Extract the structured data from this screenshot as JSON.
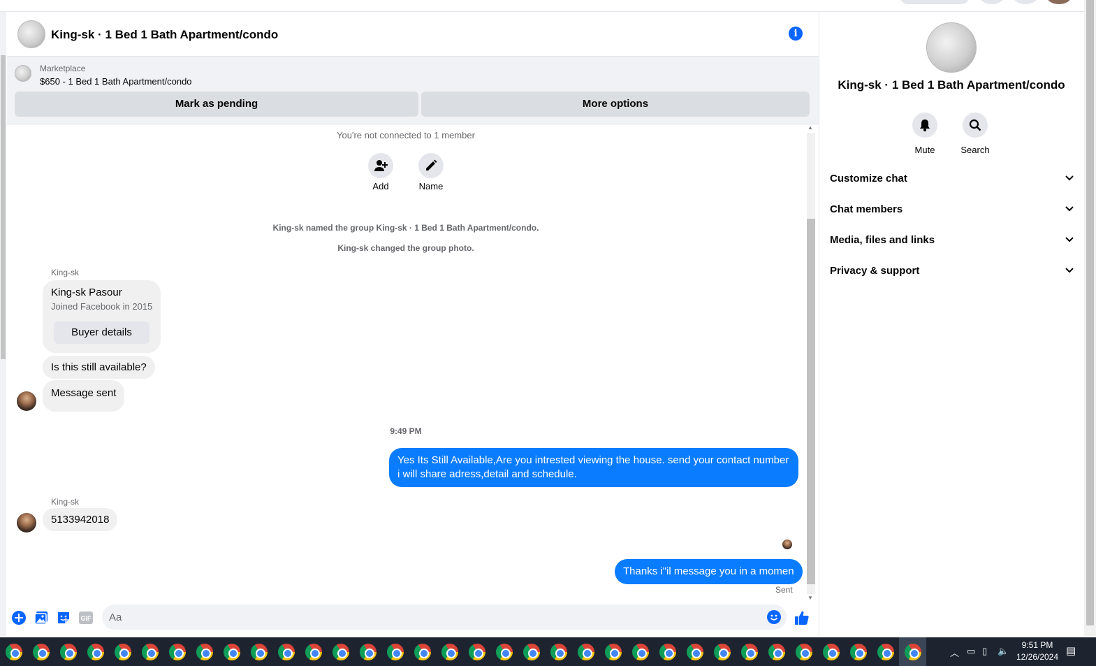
{
  "chat": {
    "title": "King-sk · 1 Bed 1 Bath Apartment/condo",
    "marketplace_label": "Marketplace",
    "listing_title": "$650 - 1 Bed 1 Bath Apartment/condo",
    "mark_pending_label": "Mark as pending",
    "more_options_label": "More options"
  },
  "messages": {
    "not_connected": "You're not connected to 1 member",
    "add_label": "Add",
    "name_label": "Name",
    "system_1": "King-sk named the group King-sk · 1 Bed 1 Bath Apartment/condo.",
    "system_2": "King-sk changed the group photo.",
    "sender_1": "King-sk",
    "buyer_name": "King-sk Pasour",
    "buyer_joined": "Joined Facebook in 2015",
    "buyer_details_label": "Buyer details",
    "msg_in_1": "Is this still available?",
    "msg_in_2": "Message sent",
    "time_1": "9:49 PM",
    "msg_out_1": "Yes Its Still Available,Are you intrested viewing the house. send your contact number i will share adress,detail and schedule.",
    "sender_2": "King-sk",
    "msg_in_3": "5133942018",
    "msg_out_2": "Thanks i\"il message you in a momen",
    "sent_status": "Sent"
  },
  "composer": {
    "placeholder": "Aa",
    "gif_label": "GIF"
  },
  "panel": {
    "title": "King-sk · 1 Bed 1 Bath Apartment/condo",
    "mute_label": "Mute",
    "search_label": "Search",
    "sections": [
      "Customize chat",
      "Chat members",
      "Media, files and links",
      "Privacy & support"
    ]
  },
  "taskbar": {
    "time": "9:51 PM",
    "date": "12/26/2024"
  },
  "colors": {
    "accent": "#0866ff",
    "outgoing_bubble": "#0a7cff"
  }
}
